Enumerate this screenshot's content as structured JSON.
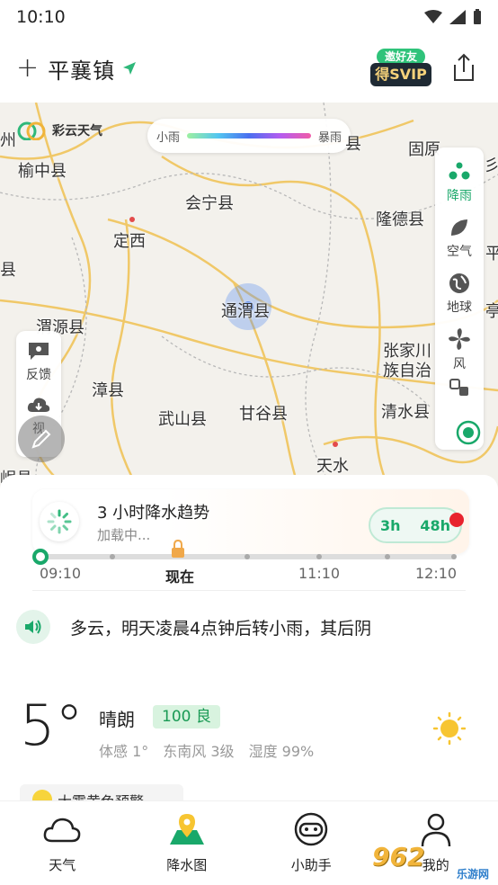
{
  "status_bar": {
    "time": "10:10"
  },
  "header": {
    "add_symbol": "+",
    "location": "平襄镇",
    "vip_top": "邀好友",
    "vip_bottom": "得SVIP"
  },
  "map": {
    "brand": "彩云天气",
    "legend": {
      "min_label": "小雨",
      "max_label": "暴雨"
    },
    "place_labels": [
      "州",
      "榆中县",
      "固原",
      "会宁县",
      "定西",
      "隆德县",
      "县",
      "通渭县",
      "渭源县",
      "张家川",
      "族自治",
      "漳县",
      "武山县",
      "甘谷县",
      "清水县",
      "天水",
      "岷县",
      "县",
      "平",
      "亭",
      "彡阳"
    ],
    "side_panel": [
      {
        "label": "降雨",
        "icon": "rain-drops-icon",
        "active": true
      },
      {
        "label": "空气",
        "icon": "leaf-icon",
        "active": false
      },
      {
        "label": "地球",
        "icon": "globe-icon",
        "active": false
      },
      {
        "label": "风",
        "icon": "fan-icon",
        "active": false
      }
    ],
    "left_panel": [
      {
        "label": "反馈",
        "icon": "feedback-icon"
      },
      {
        "label": "视",
        "icon": "download-icon"
      }
    ],
    "colors": {
      "accent": "#19a86a",
      "road": "#f0c45a",
      "border": "#b8b8b8"
    }
  },
  "precip": {
    "title": "3 小时降水趋势",
    "subtitle": "加载中...",
    "toggle_3h": "3h",
    "toggle_48h": "48h",
    "timeline_labels": [
      "09:10",
      "现在",
      "11:10",
      "12:10"
    ]
  },
  "forecast": {
    "text": "多云，明天凌晨4点钟后转小雨，其后阴"
  },
  "current": {
    "temperature": "5°",
    "condition": "晴朗",
    "aqi": "100 良",
    "feels_like": "体感 1°",
    "wind": "东南风 3级",
    "humidity": "湿度 99%"
  },
  "warning": {
    "text": "大雾黄色预警"
  },
  "bottom_nav": [
    {
      "label": "天气",
      "icon": "cloud-icon"
    },
    {
      "label": "降水图",
      "icon": "map-pin-icon"
    },
    {
      "label": "小助手",
      "icon": "assistant-icon"
    },
    {
      "label": "我的",
      "icon": "user-icon"
    }
  ],
  "watermark": {
    "main": "962",
    "sub": "乐游网"
  }
}
